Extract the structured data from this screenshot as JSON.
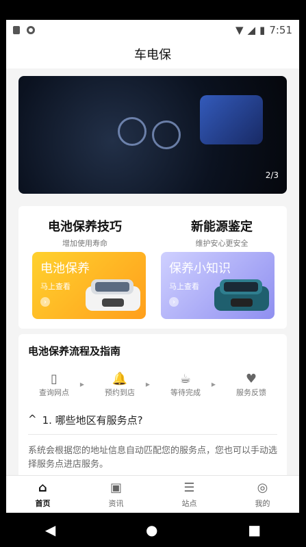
{
  "status": {
    "time": "7:51",
    "icons": [
      "sd-card-icon",
      "circle-dot-icon",
      "wifi-icon",
      "signal-icon",
      "battery-icon"
    ]
  },
  "app": {
    "title": "车电保"
  },
  "banner": {
    "index": "2/3"
  },
  "features": [
    {
      "title": "电池保养技巧",
      "subtitle": "增加使用寿命",
      "tile_label": "电池保养",
      "tile_sub": "马上查看"
    },
    {
      "title": "新能源鉴定",
      "subtitle": "维护安心更安全",
      "tile_label": "保养小知识",
      "tile_sub": "马上查看"
    }
  ],
  "section": {
    "title": "电池保养流程及指南",
    "steps": [
      "查询网点",
      "预约到店",
      "等待完成",
      "服务反馈"
    ],
    "faq_q": "1. 哪些地区有服务点?",
    "faq_a": "系统会根据您的地址信息自动匹配您的服务点，您也可以手动选择服务点进店服务。"
  },
  "tabs": [
    "首页",
    "资讯",
    "站点",
    "我的"
  ],
  "nav": {
    "back": "◀",
    "home": "●",
    "recent": "■"
  }
}
